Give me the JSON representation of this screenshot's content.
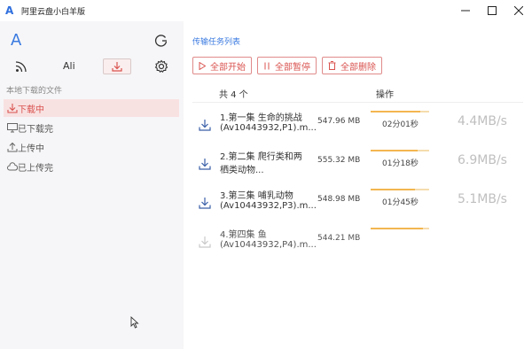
{
  "window": {
    "title": "阿里云盘小白羊版",
    "app_letter": "A",
    "minimize_glyph": "—",
    "maximize_glyph": "☐",
    "close_glyph": "✕"
  },
  "sidebar": {
    "logo_letter": "A",
    "nav": {
      "ali_label": "Ali"
    },
    "section_label": "本地下载的文件",
    "items": [
      {
        "label": "下载中",
        "icon": "download-icon",
        "active": true
      },
      {
        "label": "已下载完",
        "icon": "monitor-icon",
        "active": false
      },
      {
        "label": "上传中",
        "icon": "upload-icon",
        "active": false
      },
      {
        "label": "已上传完",
        "icon": "cloud-icon",
        "active": false
      }
    ]
  },
  "main": {
    "title": "传输任务列表",
    "toolbar": {
      "start_all": "全部开始",
      "pause_all": "全部暂停",
      "delete_all": "全部删除"
    },
    "table": {
      "count_label": "共 4 个",
      "ops_label": "操作",
      "rows": [
        {
          "name_line1": "1.第一集 生命的挑战",
          "name_line2": "(Av10443932,P1).m...",
          "size": "547.96 MB",
          "progress": 0.85,
          "eta": "02分01秒",
          "speed": "4.4MB/s"
        },
        {
          "name_line1": "2.第二集 爬行类和两",
          "name_line2": "栖类动物...",
          "size": "555.32 MB",
          "progress": 0.8,
          "eta": "01分18秒",
          "speed": "6.9MB/s"
        },
        {
          "name_line1": "3.第三集 哺乳动物",
          "name_line2": "(Av10443932,P3).m...",
          "size": "548.98 MB",
          "progress": 0.75,
          "eta": "01分45秒",
          "speed": "5.1MB/s"
        },
        {
          "name_line1": "4.第四集 鱼",
          "name_line2": "(Av10443932,P4).m...",
          "size": "544.21 MB",
          "progress": 0.9,
          "eta": "",
          "speed": ""
        }
      ]
    }
  },
  "colors": {
    "accent_red": "#d9534f",
    "accent_blue": "#3a7ae0",
    "progress": "#f3b650"
  }
}
